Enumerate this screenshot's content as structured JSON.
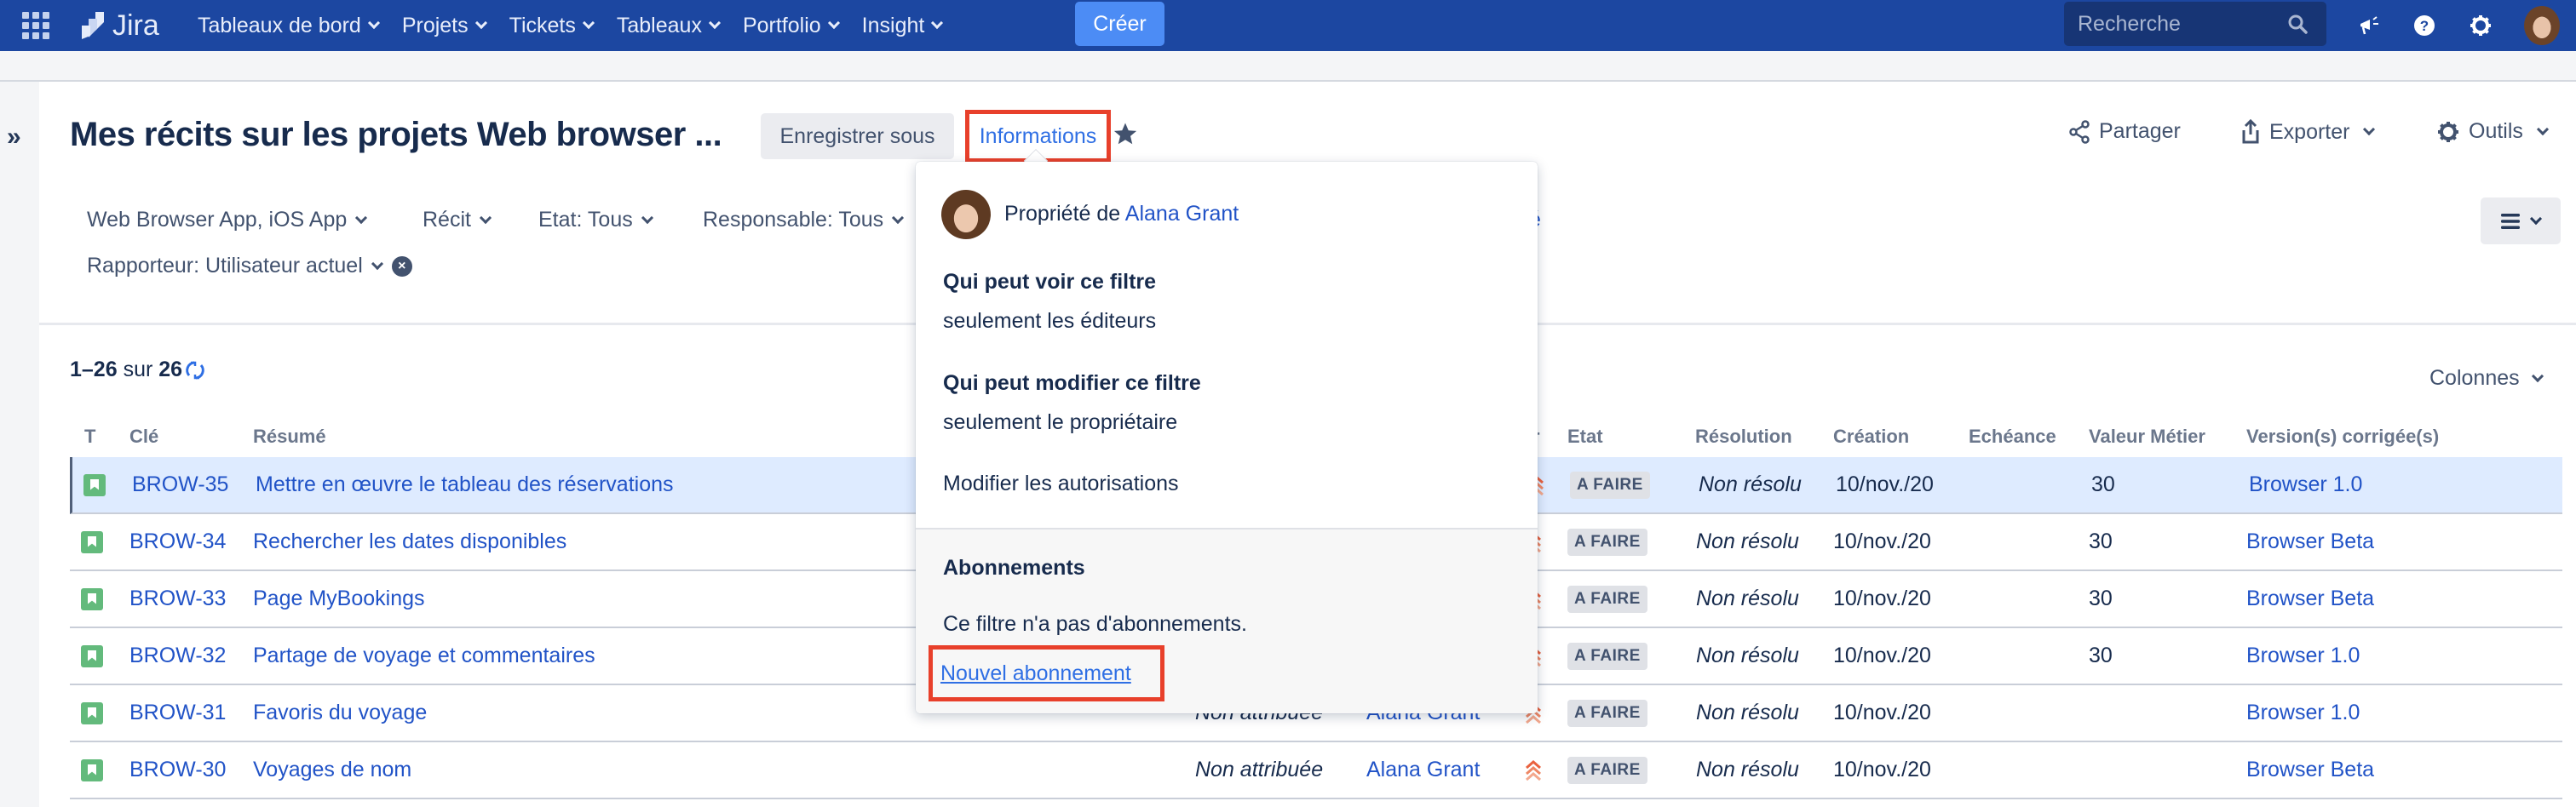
{
  "topnav": {
    "logo_text": "Jira",
    "items": [
      {
        "label": "Tableaux de bord"
      },
      {
        "label": "Projets"
      },
      {
        "label": "Tickets"
      },
      {
        "label": "Tableaux"
      },
      {
        "label": "Portfolio"
      },
      {
        "label": "Insight"
      }
    ],
    "create_label": "Créer",
    "search_placeholder": "Recherche",
    "icons": [
      "apps-grid-icon",
      "megaphone-icon",
      "help-icon",
      "settings-icon",
      "avatar"
    ]
  },
  "header": {
    "title": "Mes récits sur les projets Web browser ...",
    "save_as_label": "Enregistrer sous",
    "info_label": "Informations",
    "share_label": "Partager",
    "export_label": "Exporter",
    "tools_label": "Outils"
  },
  "filters": {
    "project": "Web Browser App, iOS App",
    "type": "Récit",
    "status": "Etat: Tous",
    "assignee": "Responsable: Tous",
    "reporter": "Rapporteur: Utilisateur actuel",
    "advanced_link_partial": "é"
  },
  "results": {
    "range": "1–26",
    "of_label": "sur",
    "total": "26",
    "columns_label": "Colonnes"
  },
  "table": {
    "headers": {
      "type": "T",
      "key": "Clé",
      "summary": "Résumé",
      "priority_partial": "r",
      "status": "Etat",
      "resolution": "Résolution",
      "created": "Création",
      "due": "Echéance",
      "business_value": "Valeur Métier",
      "fix_versions": "Version(s) corrigée(s)"
    },
    "rows": [
      {
        "key": "BROW-35",
        "summary": "Mettre en œuvre le tableau des réservations",
        "assignee": "",
        "reporter": "",
        "status": "A FAIRE",
        "resolution": "Non résolu",
        "created": "10/nov./20",
        "due": "",
        "business_value": "30",
        "fix_version": "Browser 1.0",
        "selected": true
      },
      {
        "key": "BROW-34",
        "summary": "Rechercher les dates disponibles",
        "assignee": "",
        "reporter": "",
        "status": "A FAIRE",
        "resolution": "Non résolu",
        "created": "10/nov./20",
        "due": "",
        "business_value": "30",
        "fix_version": "Browser Beta"
      },
      {
        "key": "BROW-33",
        "summary": "Page MyBookings",
        "assignee": "",
        "reporter": "",
        "status": "A FAIRE",
        "resolution": "Non résolu",
        "created": "10/nov./20",
        "due": "",
        "business_value": "30",
        "fix_version": "Browser Beta"
      },
      {
        "key": "BROW-32",
        "summary": "Partage de voyage et commentaires",
        "assignee": "",
        "reporter": "",
        "status": "A FAIRE",
        "resolution": "Non résolu",
        "created": "10/nov./20",
        "due": "",
        "business_value": "30",
        "fix_version": "Browser 1.0"
      },
      {
        "key": "BROW-31",
        "summary": "Favoris du voyage",
        "assignee": "Non attribuée",
        "reporter": "Alana Grant",
        "status": "A FAIRE",
        "resolution": "Non résolu",
        "created": "10/nov./20",
        "due": "",
        "business_value": "",
        "fix_version": "Browser 1.0"
      },
      {
        "key": "BROW-30",
        "summary": "Voyages de nom",
        "assignee": "Non attribuée",
        "reporter": "Alana Grant",
        "status": "A FAIRE",
        "resolution": "Non résolu",
        "created": "10/nov./20",
        "due": "",
        "business_value": "",
        "fix_version": "Browser Beta"
      }
    ]
  },
  "popup": {
    "owner_prefix": "Propriété de",
    "owner_name": "Alana Grant",
    "view_heading": "Qui peut voir ce filtre",
    "view_value": "seulement les éditeurs",
    "edit_heading": "Qui peut modifier ce filtre",
    "edit_value": "seulement le propriétaire",
    "edit_permissions_link": "Modifier les autorisations",
    "subscriptions_heading": "Abonnements",
    "no_subscriptions": "Ce filtre n'a pas d'abonnements.",
    "new_subscription_link": "Nouvel abonnement"
  },
  "colors": {
    "nav_bg": "#1c47a1",
    "create_btn": "#4c8cf5",
    "link": "#2153c7",
    "highlight_border": "#e8402b",
    "selected_row": "#deebff",
    "story_green": "#63ba7c",
    "priority_orange": "#e9623f"
  }
}
